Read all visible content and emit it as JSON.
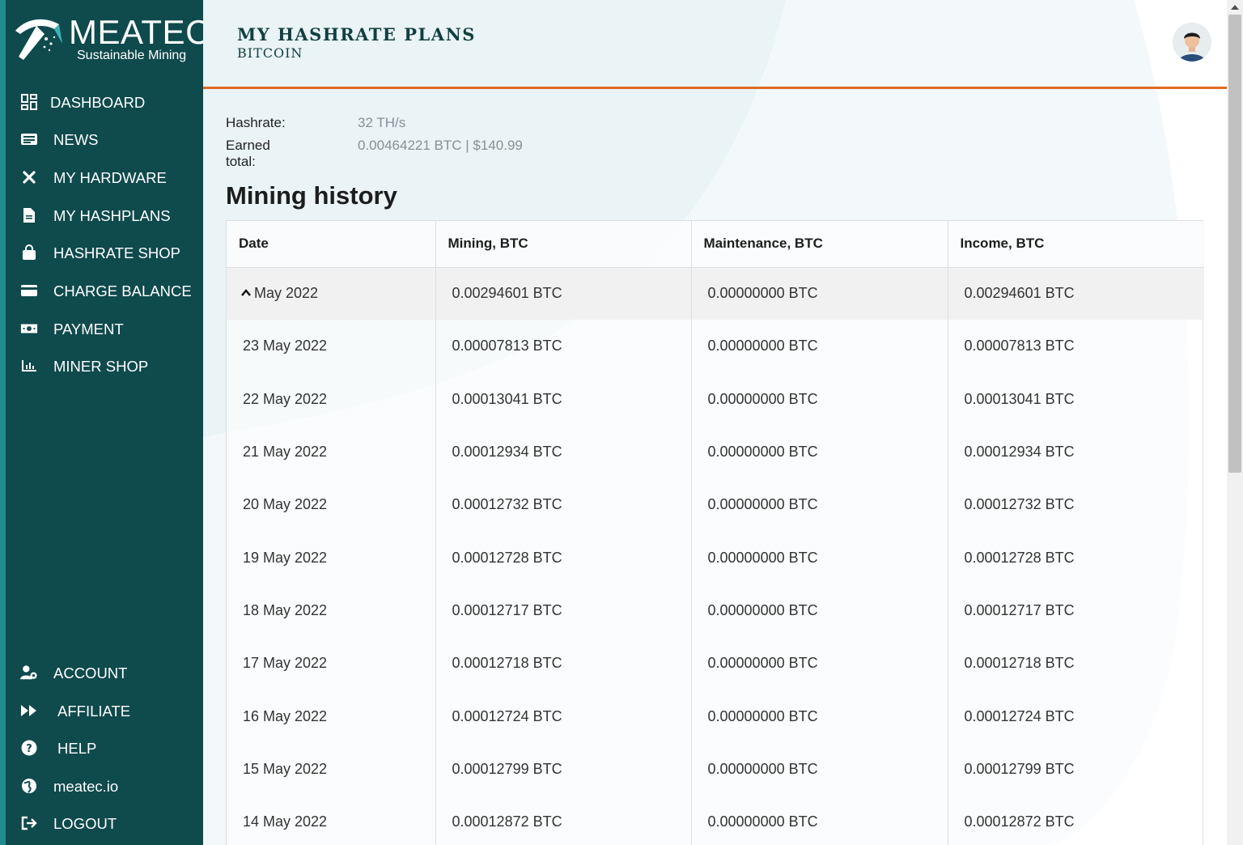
{
  "brand": {
    "name": "MEATEC",
    "tagline": "Sustainable Mining",
    "colors": {
      "sidebar": "#0f4a4d",
      "accent": "#e06a22",
      "strip": "#1f8c8e"
    }
  },
  "sidebar": {
    "top_items": [
      {
        "label": "DASHBOARD",
        "icon": "dashboard-grid-icon"
      },
      {
        "label": "NEWS",
        "icon": "newspaper-icon"
      },
      {
        "label": "MY HARDWARE",
        "icon": "tools-icon"
      },
      {
        "label": "MY HASHPLANS",
        "icon": "document-icon"
      },
      {
        "label": "HASHRATE SHOP",
        "icon": "shopping-bag-icon"
      },
      {
        "label": "CHARGE BALANCE",
        "icon": "credit-card-icon"
      },
      {
        "label": "PAYMENT",
        "icon": "money-bill-icon"
      },
      {
        "label": "MINER SHOP",
        "icon": "chart-bar-icon"
      }
    ],
    "bottom_items": [
      {
        "label": "ACCOUNT",
        "icon": "user-gear-icon"
      },
      {
        "label": "AFFILIATE",
        "icon": "fast-forward-icon"
      },
      {
        "label": "HELP",
        "icon": "question-circle-icon"
      },
      {
        "label": "meatec.io",
        "icon": "globe-icon"
      },
      {
        "label": "LOGOUT",
        "icon": "sign-out-icon"
      }
    ]
  },
  "header": {
    "title": "MY HASHRATE PLANS",
    "subtitle": "BITCOIN",
    "avatar_icon": "user-avatar-icon"
  },
  "stats": {
    "hashrate_label": "Hashrate:",
    "hashrate_value": "32 TH/s",
    "earned_label": "Earned total:",
    "earned_value": "0.00464221 BTC | $140.99"
  },
  "history": {
    "title": "Mining history",
    "columns": [
      "Date",
      "Mining, BTC",
      "Maintenance, BTC",
      "Income, BTC"
    ],
    "group": {
      "label": "May 2022",
      "mining": "0.00294601 BTC",
      "maintenance": "0.00000000 BTC",
      "income": "0.00294601 BTC",
      "expanded_icon": "chevron-up-icon"
    },
    "rows": [
      {
        "date": "23 May 2022",
        "mining": "0.00007813 BTC",
        "maintenance": "0.00000000 BTC",
        "income": "0.00007813 BTC"
      },
      {
        "date": "22 May 2022",
        "mining": "0.00013041 BTC",
        "maintenance": "0.00000000 BTC",
        "income": "0.00013041 BTC"
      },
      {
        "date": "21 May 2022",
        "mining": "0.00012934 BTC",
        "maintenance": "0.00000000 BTC",
        "income": "0.00012934 BTC"
      },
      {
        "date": "20 May 2022",
        "mining": "0.00012732 BTC",
        "maintenance": "0.00000000 BTC",
        "income": "0.00012732 BTC"
      },
      {
        "date": "19 May 2022",
        "mining": "0.00012728 BTC",
        "maintenance": "0.00000000 BTC",
        "income": "0.00012728 BTC"
      },
      {
        "date": "18 May 2022",
        "mining": "0.00012717 BTC",
        "maintenance": "0.00000000 BTC",
        "income": "0.00012717 BTC"
      },
      {
        "date": "17 May 2022",
        "mining": "0.00012718 BTC",
        "maintenance": "0.00000000 BTC",
        "income": "0.00012718 BTC"
      },
      {
        "date": "16 May 2022",
        "mining": "0.00012724 BTC",
        "maintenance": "0.00000000 BTC",
        "income": "0.00012724 BTC"
      },
      {
        "date": "15 May 2022",
        "mining": "0.00012799 BTC",
        "maintenance": "0.00000000 BTC",
        "income": "0.00012799 BTC"
      },
      {
        "date": "14 May 2022",
        "mining": "0.00012872 BTC",
        "maintenance": "0.00000000 BTC",
        "income": "0.00012872 BTC"
      }
    ]
  }
}
